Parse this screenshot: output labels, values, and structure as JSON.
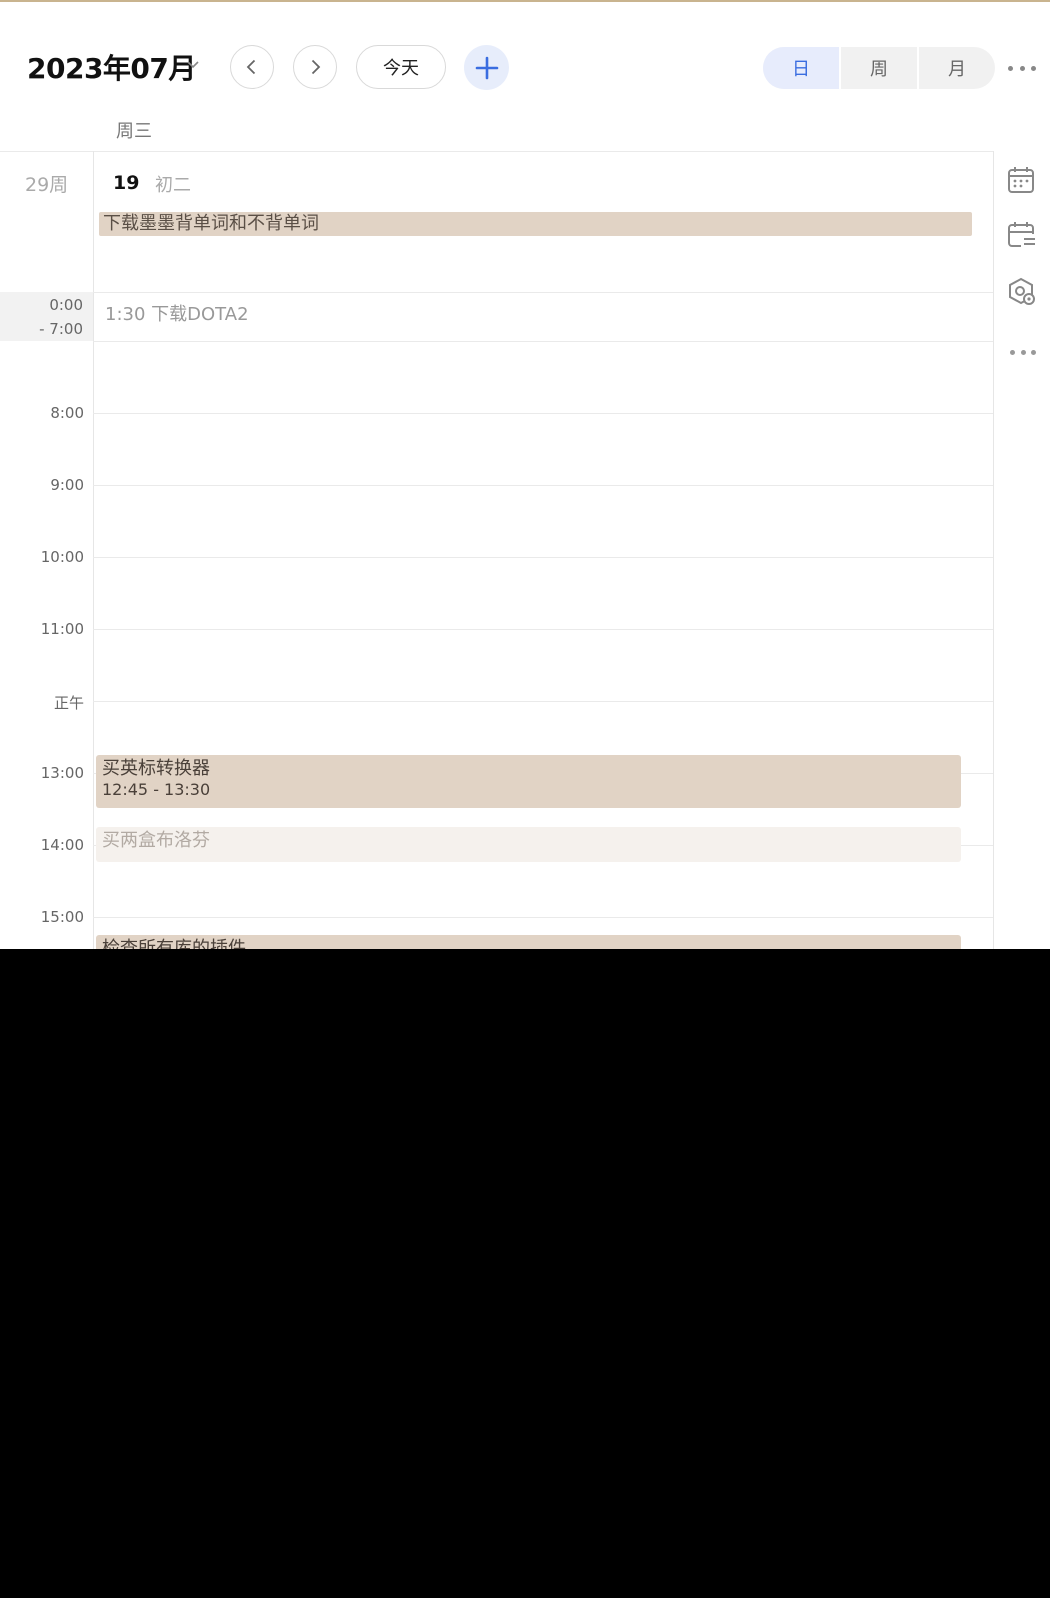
{
  "header": {
    "month": "2023年07月",
    "today_label": "今天",
    "views": [
      {
        "label": "日",
        "active": true
      },
      {
        "label": "周",
        "active": false
      },
      {
        "label": "月",
        "active": false
      }
    ]
  },
  "day": {
    "weekday": "周三",
    "week_number": "29周",
    "date": "19",
    "lunar": "初二"
  },
  "all_day_events": [
    {
      "title": "下载墨墨背单词和不背单词"
    }
  ],
  "collapsed_range": {
    "from": "0:00",
    "to": "- 7:00",
    "event": "1:30 下载DOTA2"
  },
  "hours": [
    "8:00",
    "9:00",
    "10:00",
    "11:00",
    "正午",
    "13:00",
    "14:00",
    "15:00"
  ],
  "events": [
    {
      "title": "买英标转换器",
      "time": "12:45 - 13:30",
      "style": "solid"
    },
    {
      "title": "买两盒布洛芬",
      "time": "",
      "style": "faded"
    },
    {
      "title": "检查所有库的插件",
      "time": "",
      "style": "solid"
    }
  ],
  "icons": {
    "prev": "chevron-left-icon",
    "next": "chevron-right-icon",
    "add": "plus-icon",
    "more": "more-dots-icon",
    "side": [
      "calendar-grid-icon",
      "calendar-list-icon",
      "location-settings-icon",
      "more-dots-icon"
    ]
  },
  "colors": {
    "accent": "#3a6de0",
    "event_solid": "#e1d3c5",
    "event_faded": "#f5f1ed",
    "active_view_bg": "#e7ecfc"
  }
}
